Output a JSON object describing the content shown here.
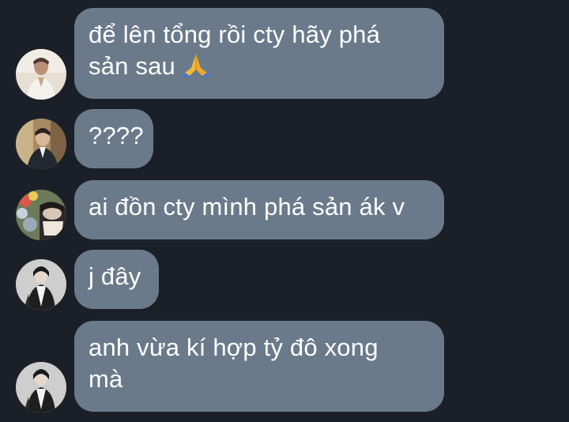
{
  "colors": {
    "background": "#1b2028",
    "bubble": "#6b7a8a",
    "text": "#ffffff"
  },
  "messages": [
    {
      "text": "để lên tổng rồi cty hãy phá\nsản sau",
      "emoji": "folded-hands-icon"
    },
    {
      "text": "????"
    },
    {
      "text": "ai đồn cty mình phá sản ák v"
    },
    {
      "text": "j đây"
    },
    {
      "text": "anh vừa kí hợp tỷ đô xong\nmà"
    }
  ]
}
